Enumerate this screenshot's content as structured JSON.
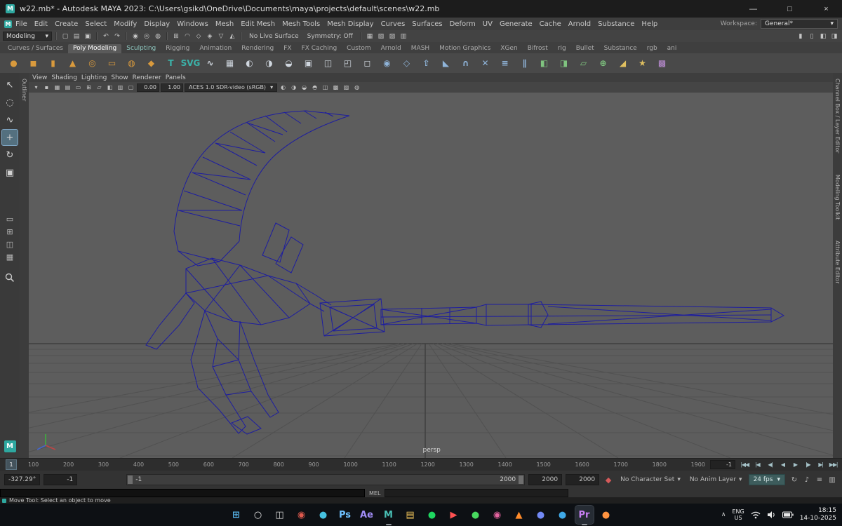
{
  "colors": {
    "viewportBg": "#5d5d5d",
    "wireframe": "#1d1da0",
    "gridLine": "#515151",
    "gridMajor": "#3e3e3e"
  },
  "window": {
    "title": "w22.mb* - Autodesk MAYA 2023: C:\\Users\\gsikd\\OneDrive\\Documents\\maya\\projects\\default\\scenes\\w22.mb",
    "controls": {
      "minimize": "—",
      "maximize": "□",
      "close": "×"
    },
    "app_badge": "M"
  },
  "menu_bar": {
    "items": [
      "File",
      "Edit",
      "Create",
      "Select",
      "Modify",
      "Display",
      "Windows",
      "Mesh",
      "Edit Mesh",
      "Mesh Tools",
      "Mesh Display",
      "Curves",
      "Surfaces",
      "Deform",
      "UV",
      "Generate",
      "Cache",
      "Arnold",
      "Substance",
      "Help"
    ],
    "workspace_label": "Workspace:",
    "workspace_value": "General*",
    "caret": "▾"
  },
  "status_line": {
    "mode": "Modeling",
    "caret": "▾",
    "icons_a": [
      {
        "sep": true
      },
      {
        "name": "new-scene-icon",
        "glyph": "▢"
      },
      {
        "name": "open-scene-icon",
        "glyph": "▤"
      },
      {
        "name": "save-scene-icon",
        "glyph": "▣"
      },
      {
        "sep": true
      },
      {
        "name": "undo-icon",
        "glyph": "↶"
      },
      {
        "name": "redo-icon",
        "glyph": "↷"
      },
      {
        "sep": true
      },
      {
        "name": "select-hierarchy-icon",
        "glyph": "◉"
      },
      {
        "name": "select-object-icon",
        "glyph": "◎"
      },
      {
        "name": "select-component-icon",
        "glyph": "◍"
      },
      {
        "sep": true
      },
      {
        "name": "snap-grid-icon",
        "glyph": "⊞"
      },
      {
        "name": "snap-curve-icon",
        "glyph": "◠"
      },
      {
        "name": "snap-point-icon",
        "glyph": "◇"
      },
      {
        "name": "snap-projected-icon",
        "glyph": "◈"
      },
      {
        "name": "snap-view-icon",
        "glyph": "▽"
      },
      {
        "name": "make-live-icon",
        "glyph": "◭"
      },
      {
        "sep": true
      }
    ],
    "live_surface": "No Live Surface",
    "symmetry": "Symmetry: Off",
    "icons_b": [
      {
        "sep": true
      },
      {
        "name": "render-frame-icon",
        "glyph": "▦"
      },
      {
        "name": "ipr-render-icon",
        "glyph": "▧"
      },
      {
        "name": "render-settings-icon",
        "glyph": "▨"
      },
      {
        "name": "display-layers-icon",
        "glyph": "▥"
      }
    ],
    "right_icons": [
      {
        "name": "channel-box-toggle-icon",
        "glyph": "▮"
      },
      {
        "name": "attribute-editor-toggle-icon",
        "glyph": "▯"
      },
      {
        "name": "tool-settings-toggle-icon",
        "glyph": "◧"
      },
      {
        "name": "modeling-toolkit-toggle-icon",
        "glyph": "◨"
      }
    ]
  },
  "shelf": {
    "tabs": [
      {
        "label": "Curves / Surfaces"
      },
      {
        "label": "Poly Modeling",
        "active": true
      },
      {
        "label": "Sculpting",
        "color": "#8ec7bf"
      },
      {
        "label": "Rigging"
      },
      {
        "label": "Animation"
      },
      {
        "label": "Rendering"
      },
      {
        "label": "FX"
      },
      {
        "label": "FX Caching"
      },
      {
        "label": "Custom"
      },
      {
        "label": "Arnold"
      },
      {
        "label": "MASH"
      },
      {
        "label": "Motion Graphics"
      },
      {
        "label": "XGen"
      },
      {
        "label": "Bifrost"
      },
      {
        "label": "rig"
      },
      {
        "label": "Bullet"
      },
      {
        "label": "Substance"
      },
      {
        "label": "rgb"
      },
      {
        "label": "ani"
      }
    ],
    "icons": [
      {
        "name": "poly-sphere-icon",
        "glyph": "●",
        "color": "#d99a3d"
      },
      {
        "name": "poly-cube-icon",
        "glyph": "◼",
        "color": "#d99a3d"
      },
      {
        "name": "poly-cylinder-icon",
        "glyph": "▮",
        "color": "#d99a3d"
      },
      {
        "name": "poly-cone-icon",
        "glyph": "▲",
        "color": "#d99a3d"
      },
      {
        "name": "poly-torus-icon",
        "glyph": "◎",
        "color": "#d99a3d"
      },
      {
        "name": "poly-plane-icon",
        "glyph": "▭",
        "color": "#d99a3d"
      },
      {
        "name": "poly-disc-icon",
        "glyph": "◍",
        "color": "#d99a3d"
      },
      {
        "name": "poly-platonic-icon",
        "glyph": "◆",
        "color": "#d99a3d"
      },
      {
        "name": "type-tool-icon",
        "glyph": "T",
        "color": "#3bb3aa"
      },
      {
        "name": "svg-tool-icon",
        "glyph": "SVG",
        "color": "#3bb3aa"
      },
      {
        "name": "sweep-mesh-icon",
        "glyph": "∿",
        "color": "#cfd6de"
      },
      {
        "name": "remesh-icon",
        "glyph": "▦",
        "color": "#cfd6de"
      },
      {
        "name": "boolean-union-icon",
        "glyph": "◐",
        "color": "#cfd6de"
      },
      {
        "name": "boolean-difference-icon",
        "glyph": "◑",
        "color": "#cfd6de"
      },
      {
        "name": "boolean-intersect-icon",
        "glyph": "◒",
        "color": "#cfd6de"
      },
      {
        "name": "combine-icon",
        "glyph": "▣",
        "color": "#cfd6de"
      },
      {
        "name": "separate-icon",
        "glyph": "◫",
        "color": "#cfd6de"
      },
      {
        "name": "extract-icon",
        "glyph": "◰",
        "color": "#cfd6de"
      },
      {
        "name": "fill-hole-icon",
        "glyph": "◻",
        "color": "#cfd6de"
      },
      {
        "name": "smooth-icon",
        "glyph": "◉",
        "color": "#8fb4d9"
      },
      {
        "name": "append-polygon-icon",
        "glyph": "◇",
        "color": "#8fb4d9"
      },
      {
        "name": "extrude-icon",
        "glyph": "⇧",
        "color": "#8fb4d9"
      },
      {
        "name": "bevel-icon",
        "glyph": "◣",
        "color": "#8fb4d9"
      },
      {
        "name": "bridge-icon",
        "glyph": "∩",
        "color": "#8fb4d9"
      },
      {
        "name": "multi-cut-icon",
        "glyph": "✕",
        "color": "#8fb4d9"
      },
      {
        "name": "insert-edge-loop-icon",
        "glyph": "≡",
        "color": "#8fb4d9"
      },
      {
        "name": "offset-edge-loop-icon",
        "glyph": "∥",
        "color": "#8fb4d9"
      },
      {
        "name": "mirror-icon",
        "glyph": "◧",
        "color": "#7fc47f"
      },
      {
        "name": "symmetry-icon",
        "glyph": "◨",
        "color": "#7fc47f"
      },
      {
        "name": "quad-draw-icon",
        "glyph": "▱",
        "color": "#7fc47f"
      },
      {
        "name": "target-weld-icon",
        "glyph": "⊕",
        "color": "#7fc47f"
      },
      {
        "name": "crease-icon",
        "glyph": "◢",
        "color": "#e0c060"
      },
      {
        "name": "sculpt-brush-icon",
        "glyph": "★",
        "color": "#e0c060"
      },
      {
        "name": "uv-editor-icon",
        "glyph": "▩",
        "color": "#c08fd9"
      }
    ]
  },
  "toolbox": {
    "tools": [
      {
        "name": "select-tool",
        "glyph": "↖"
      },
      {
        "name": "lasso-tool",
        "glyph": "◌"
      },
      {
        "name": "paint-select-tool",
        "glyph": "∿"
      },
      {
        "name": "move-tool",
        "glyph": "+",
        "active": true
      },
      {
        "name": "rotate-tool",
        "glyph": "↻"
      },
      {
        "name": "scale-tool",
        "glyph": "▣"
      }
    ],
    "layouts": [
      {
        "name": "single-pane-layout",
        "glyph": "▭"
      },
      {
        "name": "four-pane-layout",
        "glyph": "⊞"
      },
      {
        "name": "persp-outliner-layout",
        "glyph": "◫"
      },
      {
        "name": "hypershade-layout",
        "glyph": "▦"
      }
    ],
    "maya_badge": "M"
  },
  "panel": {
    "menus": [
      "View",
      "Shading",
      "Lighting",
      "Show",
      "Renderer",
      "Panels"
    ],
    "left_tabs": [
      "Outliner"
    ],
    "right_tabs": [
      "Channel Box / Layer Editor",
      "Modeling Toolkit",
      "Attribute Editor"
    ],
    "toolbar": {
      "icons_a": [
        {
          "name": "camera-select-icon",
          "glyph": "▾"
        },
        {
          "name": "lock-camera-icon",
          "glyph": "▪"
        },
        {
          "name": "camera-attributes-icon",
          "glyph": "▦"
        },
        {
          "name": "bookmark-icon",
          "glyph": "▤"
        },
        {
          "name": "image-plane-icon",
          "glyph": "▭"
        },
        {
          "name": "view-grid-icon",
          "glyph": "⊞"
        },
        {
          "name": "film-gate-icon",
          "glyph": "▱"
        },
        {
          "name": "resolution-gate-icon",
          "glyph": "◧"
        },
        {
          "name": "gate-mask-icon",
          "glyph": "▥"
        },
        {
          "name": "safe-action-icon",
          "glyph": "▢"
        }
      ],
      "exposure": "0.00",
      "gamma": "1.00",
      "colorspace": "ACES 1.0 SDR-video (sRGB)",
      "caret": "▾",
      "icons_b": [
        {
          "name": "lighting-icon",
          "glyph": "◐"
        },
        {
          "name": "shadows-icon",
          "glyph": "◑"
        },
        {
          "name": "ssao-icon",
          "glyph": "◒"
        },
        {
          "name": "anti-alias-icon",
          "glyph": "◓"
        },
        {
          "name": "xray-icon",
          "glyph": "◫"
        },
        {
          "name": "wireframe-on-shaded-icon",
          "glyph": "▩"
        },
        {
          "name": "textured-icon",
          "glyph": "▨"
        },
        {
          "name": "isolate-select-icon",
          "glyph": "◍"
        }
      ]
    },
    "camera_label": "persp"
  },
  "time_slider": {
    "current": "1",
    "ticks": [
      "100",
      "200",
      "300",
      "400",
      "500",
      "600",
      "700",
      "800",
      "900",
      "1000",
      "1100",
      "1200",
      "1300",
      "1400",
      "1500",
      "1600",
      "1700",
      "1800",
      "1900"
    ],
    "end_field": "-1",
    "playback": [
      {
        "name": "go-to-start-button",
        "glyph": "|◀◀"
      },
      {
        "name": "step-back-frame-button",
        "glyph": "|◀"
      },
      {
        "name": "step-back-key-button",
        "glyph": "◀|"
      },
      {
        "name": "play-backwards-button",
        "glyph": "◀"
      },
      {
        "name": "play-forward-button",
        "glyph": "▶"
      },
      {
        "name": "step-forward-key-button",
        "glyph": "|▶"
      },
      {
        "name": "step-forward-frame-button",
        "glyph": "▶|"
      },
      {
        "name": "go-to-end-button",
        "glyph": "▶▶|"
      }
    ]
  },
  "range_slider": {
    "field_a": "-327.29°",
    "field_b": "-1",
    "range_start": "-1",
    "range_end": "2000",
    "field_c": "2000",
    "field_d": "2000",
    "autokey_glyph": "◆",
    "character_set": "No Character Set",
    "anim_layer": "No Anim Layer",
    "fps": "24 fps",
    "caret": "▾",
    "icons": [
      {
        "name": "playback-loop-icon",
        "glyph": "↻"
      },
      {
        "name": "mute-sound-icon",
        "glyph": "♪"
      },
      {
        "name": "anim-prefs-icon",
        "glyph": "≡"
      },
      {
        "name": "graph-editor-toggle-icon",
        "glyph": "▥"
      }
    ]
  },
  "command_line": {
    "mel": "MEL"
  },
  "help_line": {
    "text": "Move Tool: Select an object to move"
  },
  "taskbar": {
    "icons": [
      {
        "name": "start-button",
        "glyph": "⊞",
        "color": "#57b3e8"
      },
      {
        "name": "search-icon",
        "glyph": "○",
        "color": "#e6e6e6"
      },
      {
        "name": "task-view-icon",
        "glyph": "◫",
        "color": "#d6d6d6"
      },
      {
        "name": "chrome-icon",
        "glyph": "◉",
        "color": "#e05a4e"
      },
      {
        "name": "edge-icon",
        "glyph": "●",
        "color": "#46c1e0"
      },
      {
        "name": "photoshop-icon",
        "glyph": "Ps",
        "color": "#6fc1ff"
      },
      {
        "name": "after-effects-icon",
        "glyph": "Ae",
        "color": "#a08cf5"
      },
      {
        "name": "maya-icon",
        "glyph": "M",
        "color": "#49c0b6",
        "open": true
      },
      {
        "name": "file-explorer-icon",
        "glyph": "▤",
        "color": "#f0c35a"
      },
      {
        "name": "spotify-icon",
        "glyph": "●",
        "color": "#1ed760"
      },
      {
        "name": "youtube-icon",
        "glyph": "▶",
        "color": "#ff5252"
      },
      {
        "name": "whatsapp-icon",
        "glyph": "●",
        "color": "#48d95f"
      },
      {
        "name": "instagram-icon",
        "glyph": "◉",
        "color": "#e564a0"
      },
      {
        "name": "vlc-icon",
        "glyph": "▲",
        "color": "#ff8b2a"
      },
      {
        "name": "discord-icon",
        "glyph": "●",
        "color": "#7289f5"
      },
      {
        "name": "telegram-icon",
        "glyph": "●",
        "color": "#3fa9e8"
      },
      {
        "name": "premiere-icon",
        "glyph": "Pr",
        "color": "#c77ff2",
        "open": true,
        "active": true
      },
      {
        "name": "firefox-icon",
        "glyph": "●",
        "color": "#ff9440"
      }
    ],
    "tray": {
      "chevron": "∧",
      "lang_line1": "ENG",
      "lang_line2": "US",
      "time": "18:15",
      "date": "14-10-2025"
    }
  }
}
